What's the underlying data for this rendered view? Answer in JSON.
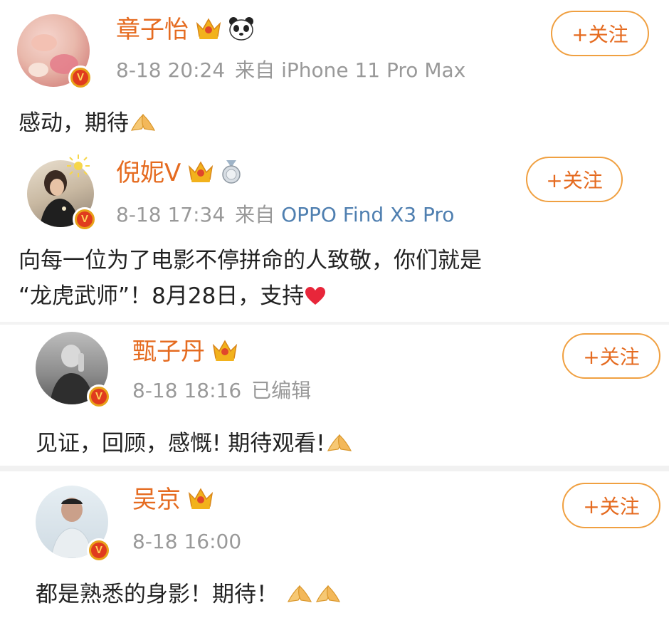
{
  "posts": [
    {
      "name": "章子怡",
      "time": "8-18 20:24",
      "source_prefix": "来自",
      "device": "iPhone 11 Pro Max",
      "follow_label": "+关注",
      "content": "感动，期待",
      "icons": [
        "crown-icon",
        "panda-icon",
        "praying-hands-emoji"
      ]
    },
    {
      "name": "倪妮V",
      "time": "8-18 17:34",
      "source_prefix": "来自",
      "device": "OPPO Find X3 Pro",
      "follow_label": "+关注",
      "content_line1": "向每一位为了电影不停拼命的人致敬，你们就是",
      "content_line2": "“龙虎武师”！8月28日，支持",
      "icons": [
        "crown-icon",
        "silver-medal-icon",
        "heart-emoji"
      ]
    },
    {
      "name": "甄子丹",
      "time": "8-18 18:16",
      "edited": "已编辑",
      "follow_label": "+关注",
      "content": "见证，回顾，感慨! 期待观看!",
      "icons": [
        "crown-icon",
        "praying-hands-emoji"
      ]
    },
    {
      "name": "吴京",
      "time": "8-18 16:00",
      "follow_label": "+关注",
      "content": "都是熟悉的身影！期待！",
      "icons": [
        "crown-icon",
        "praying-hands-emoji",
        "praying-hands-emoji"
      ]
    }
  ],
  "badge_letter": "V",
  "colors": {
    "name": "#e56b20",
    "follow_border": "#f0a041",
    "meta": "#999999",
    "device_link": "#4f7fb0",
    "badge_outer": "#e8a21a",
    "badge_inner": "#e03b1e",
    "heart": "#e8263a"
  }
}
